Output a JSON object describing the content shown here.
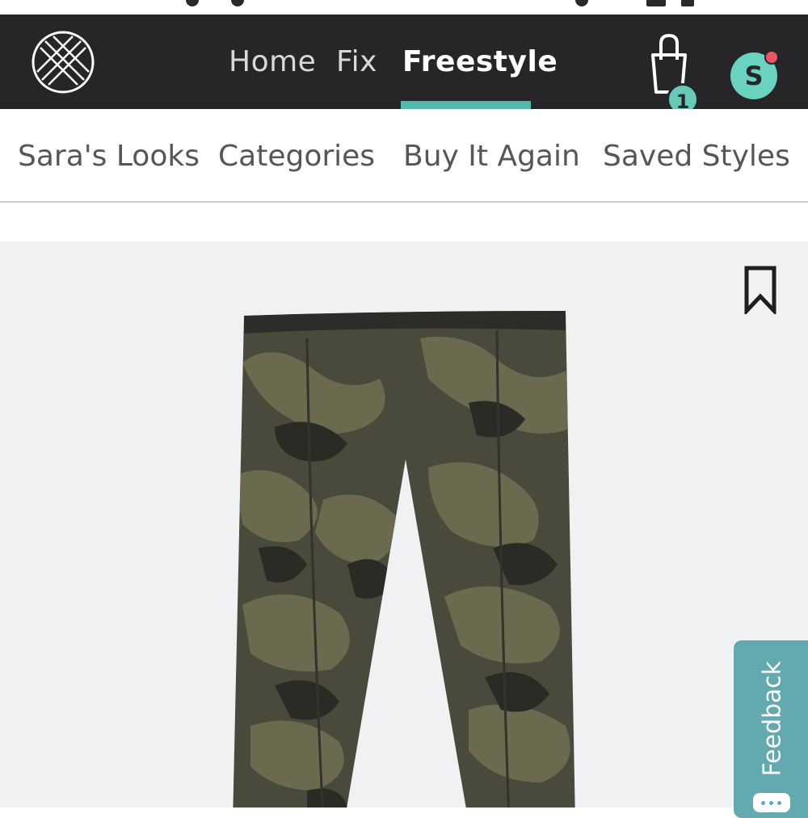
{
  "nav": {
    "items": [
      {
        "label": "Home"
      },
      {
        "label": "Fix"
      },
      {
        "label": "Freestyle"
      }
    ],
    "active": "Freestyle",
    "bag_count": "1",
    "avatar_initial": "S"
  },
  "subnav": {
    "items": [
      {
        "label": "Sara's Looks"
      },
      {
        "label": "Categories"
      },
      {
        "label": "Buy It Again"
      },
      {
        "label": "Saved Styles"
      }
    ]
  },
  "product": {
    "image_icon": "camo-pants-image",
    "bookmark_icon": "bookmark-icon"
  },
  "feedback": {
    "label": "Feedback"
  },
  "colors": {
    "topbar": "#262629",
    "accent": "#50b8ad",
    "avatar": "#69d3bf",
    "notification": "#ea5560",
    "feedback_tab": "#63aab0"
  }
}
